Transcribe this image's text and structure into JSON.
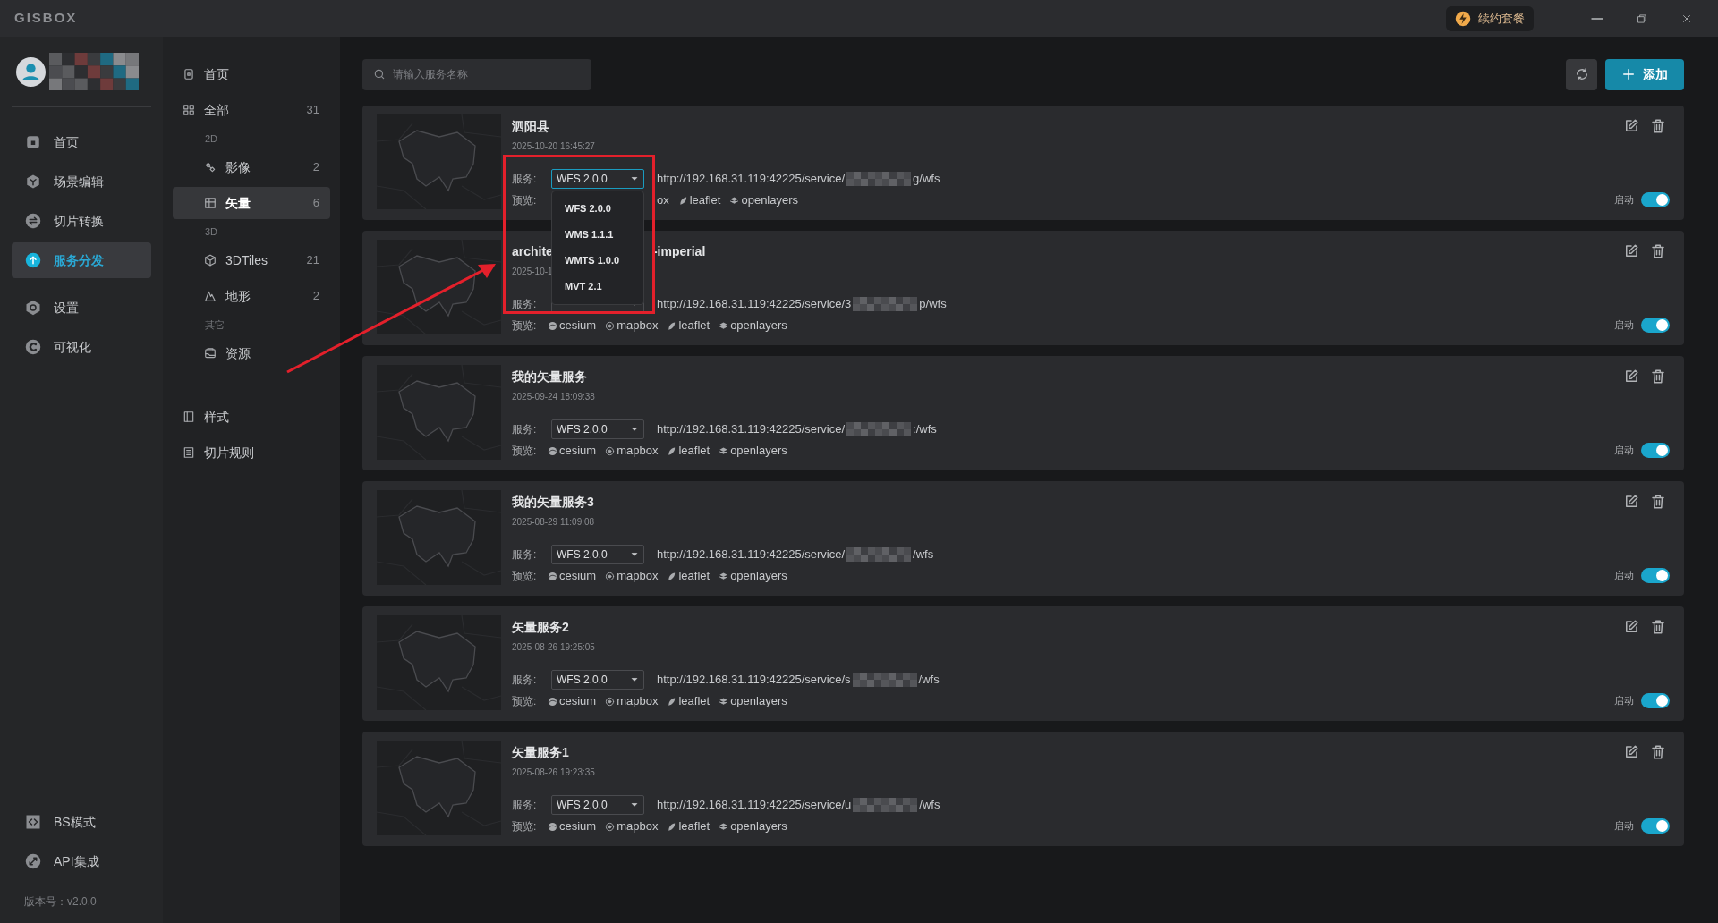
{
  "title_bar": {
    "logo": "GISBOX",
    "renew_button": "续约套餐"
  },
  "main_nav": {
    "primary": [
      {
        "label": "首页",
        "selected": false
      },
      {
        "label": "场景编辑",
        "selected": false
      },
      {
        "label": "切片转换",
        "selected": false
      },
      {
        "label": "服务分发",
        "selected": true
      }
    ],
    "secondary": [
      {
        "label": "设置",
        "selected": false
      },
      {
        "label": "可视化",
        "selected": false
      }
    ],
    "footer": [
      {
        "label": "BS模式",
        "selected": false
      },
      {
        "label": "API集成",
        "selected": false
      }
    ],
    "version": "版本号：v2.0.0"
  },
  "category_nav": [
    {
      "kind": "link",
      "label": "首页",
      "selected": false
    },
    {
      "kind": "link",
      "label": "全部",
      "count": "31",
      "selected": false
    },
    {
      "kind": "heading",
      "label": "2D"
    },
    {
      "kind": "sub",
      "label": "影像",
      "count": "2",
      "selected": false
    },
    {
      "kind": "sub",
      "label": "矢量",
      "count": "6",
      "selected": true
    },
    {
      "kind": "heading",
      "label": "3D"
    },
    {
      "kind": "sub",
      "label": "3DTiles",
      "count": "21",
      "selected": false
    },
    {
      "kind": "sub",
      "label": "地形",
      "count": "2",
      "selected": false
    },
    {
      "kind": "heading",
      "label": "其它"
    },
    {
      "kind": "sub",
      "label": "资源",
      "selected": false
    },
    {
      "kind": "divider"
    },
    {
      "kind": "link",
      "label": "样式",
      "selected": false
    },
    {
      "kind": "link",
      "label": "切片规则",
      "selected": false
    }
  ],
  "toolbar": {
    "search_placeholder": "请输入服务名称",
    "add_button": "添加"
  },
  "services": [
    {
      "title": "泗阳县",
      "date": "2025-10-20 16:45:27",
      "service_label": "服务:",
      "service": "WFS 2.0.0",
      "service_menu": [
        "WFS 2.0.0",
        "WMS 1.1.1",
        "WMTS 1.0.0",
        "MVT 2.1"
      ],
      "url_prefix": "http://192.168.31.119:42225/service/",
      "url_suffix": "g/wfs",
      "preview_label": "预览:",
      "previews": [
        {
          "kind": "cut",
          "label": "ox"
        },
        {
          "kind": "full",
          "label": "leaflet"
        },
        {
          "kind": "full",
          "label": "openlayers"
        }
      ],
      "enabled_label": "启动",
      "enabled": true
    },
    {
      "title": "archite",
      "title_tail": "-imperial",
      "date": "2025-10-1",
      "service_label": "服务:",
      "url_prefix": "http://192.168.31.119:42225/service/3",
      "url_suffix": "p/wfs",
      "preview_label": "预览:",
      "previews": [
        {
          "kind": "full",
          "label": "cesium"
        },
        {
          "kind": "full",
          "label": "mapbox"
        },
        {
          "kind": "full",
          "label": "leaflet"
        },
        {
          "kind": "full",
          "label": "openlayers"
        }
      ],
      "enabled_label": "启动",
      "enabled": true
    },
    {
      "title": "我的矢量服务",
      "date": "2025-09-24 18:09:38",
      "service_label": "服务:",
      "service": "WFS 2.0.0",
      "url_prefix": "http://192.168.31.119:42225/service/",
      "url_suffix": ":/wfs",
      "preview_label": "预览:",
      "previews": [
        {
          "kind": "full",
          "label": "cesium"
        },
        {
          "kind": "full",
          "label": "mapbox"
        },
        {
          "kind": "full",
          "label": "leaflet"
        },
        {
          "kind": "full",
          "label": "openlayers"
        }
      ],
      "enabled_label": "启动",
      "enabled": true
    },
    {
      "title": "我的矢量服务3",
      "date": "2025-08-29 11:09:08",
      "service_label": "服务:",
      "service": "WFS 2.0.0",
      "url_prefix": "http://192.168.31.119:42225/service/",
      "url_suffix": "/wfs",
      "preview_label": "预览:",
      "previews": [
        {
          "kind": "full",
          "label": "cesium"
        },
        {
          "kind": "full",
          "label": "mapbox"
        },
        {
          "kind": "full",
          "label": "leaflet"
        },
        {
          "kind": "full",
          "label": "openlayers"
        }
      ],
      "enabled_label": "启动",
      "enabled": true
    },
    {
      "title": "矢量服务2",
      "date": "2025-08-26 19:25:05",
      "service_label": "服务:",
      "service": "WFS 2.0.0",
      "url_prefix": "http://192.168.31.119:42225/service/s",
      "url_suffix": "/wfs",
      "preview_label": "预览:",
      "previews": [
        {
          "kind": "full",
          "label": "cesium"
        },
        {
          "kind": "full",
          "label": "mapbox"
        },
        {
          "kind": "full",
          "label": "leaflet"
        },
        {
          "kind": "full",
          "label": "openlayers"
        }
      ],
      "enabled_label": "启动",
      "enabled": true
    },
    {
      "title": "矢量服务1",
      "date": "2025-08-26 19:23:35",
      "service_label": "服务:",
      "service": "WFS 2.0.0",
      "url_prefix": "http://192.168.31.119:42225/service/u",
      "url_suffix": "/wfs",
      "preview_label": "预览:",
      "previews": [
        {
          "kind": "full",
          "label": "cesium"
        },
        {
          "kind": "full",
          "label": "mapbox"
        },
        {
          "kind": "full",
          "label": "leaflet"
        },
        {
          "kind": "full",
          "label": "openlayers"
        }
      ],
      "enabled_label": "启动",
      "enabled": true
    }
  ]
}
